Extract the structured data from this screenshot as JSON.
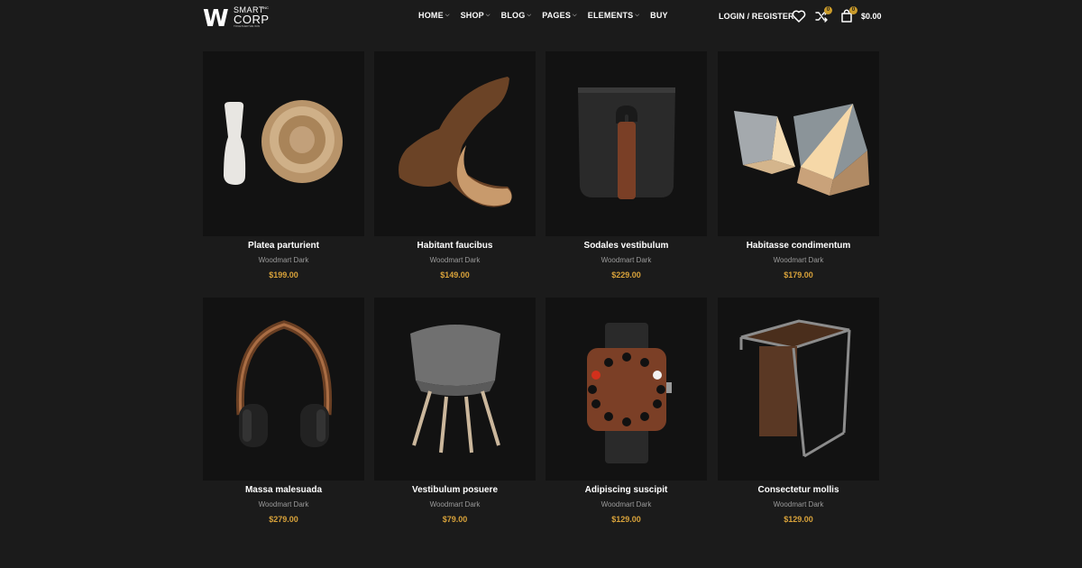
{
  "header": {
    "logo": {
      "mark": "W",
      "line1": "SMART",
      "line2": "CORP",
      "superscript": "INC",
      "tagline": "TOGETHER WE WIN"
    },
    "nav": [
      {
        "label": "HOME",
        "has_dropdown": true
      },
      {
        "label": "SHOP",
        "has_dropdown": true
      },
      {
        "label": "BLOG",
        "has_dropdown": true
      },
      {
        "label": "PAGES",
        "has_dropdown": true
      },
      {
        "label": "ELEMENTS",
        "has_dropdown": true
      },
      {
        "label": "BUY",
        "has_dropdown": false
      }
    ],
    "login_label": "LOGIN / REGISTER",
    "compare_count": "0",
    "cart_count": "0",
    "cart_total": "$0.00",
    "icons": [
      "heart-icon",
      "compare-icon",
      "cart-icon"
    ]
  },
  "colors": {
    "background": "#1b1b1b",
    "card": "#121212",
    "price": "#d8a23a",
    "badge": "#c99a2a",
    "category": "#9a9a9a"
  },
  "products": [
    {
      "name": "Platea parturient",
      "category": "Woodmart Dark",
      "price": "$199.00",
      "image": "wooden-bowl-and-pestle"
    },
    {
      "name": "Habitant faucibus",
      "category": "Woodmart Dark",
      "price": "$149.00",
      "image": "wooden-rocking-chair"
    },
    {
      "name": "Sodales vestibulum",
      "category": "Woodmart Dark",
      "price": "$229.00",
      "image": "black-mug-wood-handle"
    },
    {
      "name": "Habitasse condimentum",
      "category": "Woodmart Dark",
      "price": "$179.00",
      "image": "geometric-lamps"
    },
    {
      "name": "Massa malesuada",
      "category": "Woodmart Dark",
      "price": "$279.00",
      "image": "wooden-headphones"
    },
    {
      "name": "Vestibulum posuere",
      "category": "Woodmart Dark",
      "price": "$79.00",
      "image": "grey-shell-chair"
    },
    {
      "name": "Adipiscing suscipit",
      "category": "Woodmart Dark",
      "price": "$129.00",
      "image": "wooden-watch"
    },
    {
      "name": "Consectetur mollis",
      "category": "Woodmart Dark",
      "price": "$129.00",
      "image": "metal-wood-side-table"
    }
  ]
}
